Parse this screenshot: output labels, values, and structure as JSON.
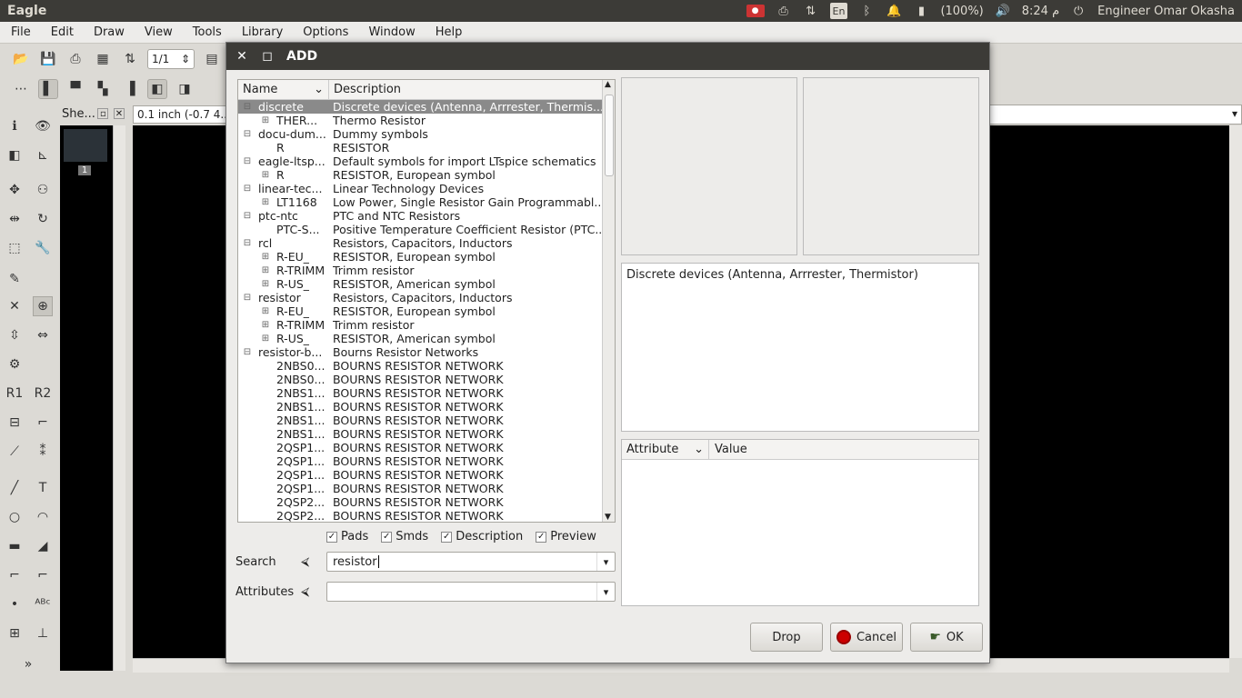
{
  "system": {
    "app_title": "Eagle",
    "battery": "(100%)",
    "clock": "م 8:24",
    "user": "Engineer Omar Okasha",
    "lang": "En"
  },
  "menu": [
    "File",
    "Edit",
    "Draw",
    "View",
    "Tools",
    "Library",
    "Options",
    "Window",
    "Help"
  ],
  "toolbar": {
    "sheet_spin": "1/1"
  },
  "sheets_panel": {
    "title": "She...",
    "sheet_number": "1"
  },
  "coord_display": "0.1 inch (-0.7 4...",
  "dialog": {
    "title": "ADD",
    "tree_headers": {
      "name": "Name",
      "description": "Description"
    },
    "rows": [
      {
        "name": "discrete",
        "desc": "Discrete devices (Antenna, Arrrester, Thermis...",
        "level": 0,
        "exp": "⊟",
        "selected": true
      },
      {
        "name": "THER...",
        "desc": "Thermo Resistor",
        "level": 1,
        "exp": "⊞"
      },
      {
        "name": "docu-dum...",
        "desc": "Dummy symbols",
        "level": 0,
        "exp": "⊟"
      },
      {
        "name": "R",
        "desc": "RESISTOR",
        "level": 1,
        "exp": ""
      },
      {
        "name": "eagle-ltsp...",
        "desc": "Default symbols for import LTspice schematics",
        "level": 0,
        "exp": "⊟"
      },
      {
        "name": "R",
        "desc": "RESISTOR, European symbol",
        "level": 1,
        "exp": "⊞"
      },
      {
        "name": "linear-tec...",
        "desc": "Linear Technology Devices",
        "level": 0,
        "exp": "⊟"
      },
      {
        "name": "LT1168",
        "desc": "Low Power, Single Resistor Gain Programmabl...",
        "level": 1,
        "exp": "⊞"
      },
      {
        "name": "ptc-ntc",
        "desc": "PTC and NTC Resistors",
        "level": 0,
        "exp": "⊟"
      },
      {
        "name": "PTC-S...",
        "desc": "Positive Temperature Coefficient Resistor (PTC...",
        "level": 1,
        "exp": ""
      },
      {
        "name": "rcl",
        "desc": "Resistors, Capacitors, Inductors",
        "level": 0,
        "exp": "⊟"
      },
      {
        "name": "R-EU_",
        "desc": "RESISTOR, European symbol",
        "level": 1,
        "exp": "⊞"
      },
      {
        "name": "R-TRIMM",
        "desc": "Trimm resistor",
        "level": 1,
        "exp": "⊞"
      },
      {
        "name": "R-US_",
        "desc": "RESISTOR, American symbol",
        "level": 1,
        "exp": "⊞"
      },
      {
        "name": "resistor",
        "desc": "Resistors, Capacitors, Inductors",
        "level": 0,
        "exp": "⊟"
      },
      {
        "name": "R-EU_",
        "desc": "RESISTOR, European symbol",
        "level": 1,
        "exp": "⊞"
      },
      {
        "name": "R-TRIMM",
        "desc": "Trimm resistor",
        "level": 1,
        "exp": "⊞"
      },
      {
        "name": "R-US_",
        "desc": "RESISTOR, American symbol",
        "level": 1,
        "exp": "⊞"
      },
      {
        "name": "resistor-b...",
        "desc": "Bourns Resistor Networks",
        "level": 0,
        "exp": "⊟"
      },
      {
        "name": "2NBS0...",
        "desc": "BOURNS RESISTOR NETWORK",
        "level": 1,
        "exp": ""
      },
      {
        "name": "2NBS0...",
        "desc": "BOURNS RESISTOR NETWORK",
        "level": 1,
        "exp": ""
      },
      {
        "name": "2NBS1...",
        "desc": "BOURNS RESISTOR NETWORK",
        "level": 1,
        "exp": ""
      },
      {
        "name": "2NBS1...",
        "desc": "BOURNS RESISTOR NETWORK",
        "level": 1,
        "exp": ""
      },
      {
        "name": "2NBS1...",
        "desc": "BOURNS RESISTOR NETWORK",
        "level": 1,
        "exp": ""
      },
      {
        "name": "2NBS1...",
        "desc": "BOURNS RESISTOR NETWORK",
        "level": 1,
        "exp": ""
      },
      {
        "name": "2QSP1...",
        "desc": "BOURNS RESISTOR NETWORK",
        "level": 1,
        "exp": ""
      },
      {
        "name": "2QSP1...",
        "desc": "BOURNS RESISTOR NETWORK",
        "level": 1,
        "exp": ""
      },
      {
        "name": "2QSP1...",
        "desc": "BOURNS RESISTOR NETWORK",
        "level": 1,
        "exp": ""
      },
      {
        "name": "2QSP1...",
        "desc": "BOURNS RESISTOR NETWORK",
        "level": 1,
        "exp": ""
      },
      {
        "name": "2QSP2...",
        "desc": "BOURNS RESISTOR NETWORK",
        "level": 1,
        "exp": ""
      },
      {
        "name": "2QSP2...",
        "desc": "BOURNS RESISTOR NETWORK",
        "level": 1,
        "exp": ""
      }
    ],
    "checkboxes": [
      {
        "label": "Pads",
        "checked": true
      },
      {
        "label": "Smds",
        "checked": true
      },
      {
        "label": "Description",
        "checked": true
      },
      {
        "label": "Preview",
        "checked": true
      }
    ],
    "search": {
      "label": "Search",
      "value": "resistor"
    },
    "attributes": {
      "label": "Attributes",
      "value": ""
    },
    "description_text": "Discrete devices (Antenna, Arrrester, Thermistor)",
    "attr_headers": {
      "attribute": "Attribute",
      "value": "Value"
    },
    "buttons": {
      "drop": "Drop",
      "cancel": "Cancel",
      "ok": "OK"
    }
  }
}
